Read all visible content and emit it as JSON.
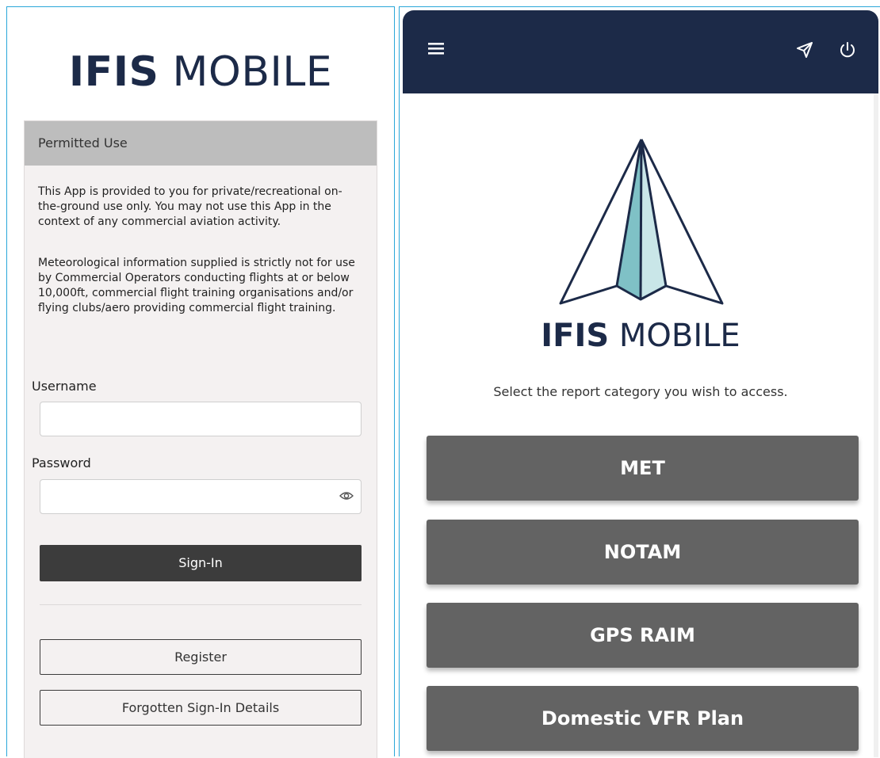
{
  "left": {
    "logo": {
      "bold": "IFIS",
      "light": " MOBILE"
    },
    "card": {
      "header": "Permitted Use",
      "paragraphs": [
        "This App is provided to you for private/recreational on-the-ground use only. You may not use this App in the context of any commercial aviation activity.",
        "Meteorological information supplied is strictly not for use by Commercial Operators conducting flights at or below 10,000ft, commercial flight training organisations and/or flying clubs/aero providing commercial flight training."
      ],
      "username_label": "Username",
      "username_value": "",
      "password_label": "Password",
      "password_value": "",
      "signin_label": "Sign-In",
      "register_label": "Register",
      "forgot_label": "Forgotten Sign-In Details"
    }
  },
  "right": {
    "topbar_color": "#1c2a48",
    "icons": [
      "menu-icon",
      "send-icon",
      "power-icon"
    ],
    "title": {
      "bold": "IFIS",
      "light": " MOBILE"
    },
    "prompt": "Select the report category you wish to access.",
    "categories": [
      "MET",
      "NOTAM",
      "GPS RAIM",
      "Domestic VFR Plan"
    ]
  }
}
